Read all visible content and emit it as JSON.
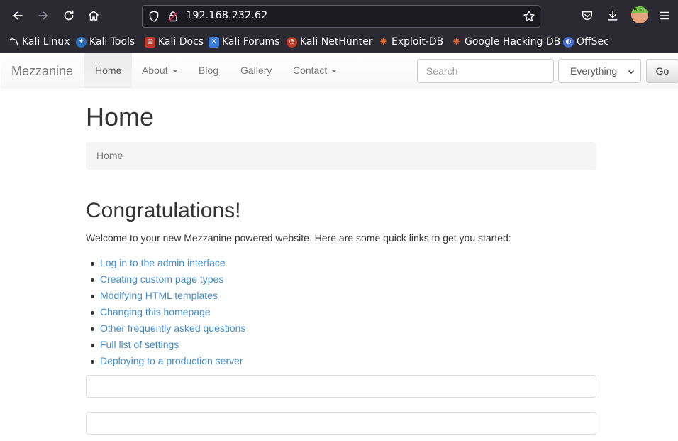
{
  "browser": {
    "url": "192.168.232.62",
    "burp_label": "Burp",
    "bookmarks": [
      {
        "label": "Kali Linux",
        "color": "#3b3b3b"
      },
      {
        "label": "Kali Tools",
        "color": "#2a6ebb"
      },
      {
        "label": "Kali Docs",
        "color": "#c0392b"
      },
      {
        "label": "Kali Forums",
        "color": "#3a7bd5"
      },
      {
        "label": "Kali NetHunter",
        "color": "#c0392b"
      },
      {
        "label": "Exploit-DB",
        "color": "#e0662a"
      },
      {
        "label": "Google Hacking DB",
        "color": "#e0662a"
      },
      {
        "label": "OffSec",
        "color": "#4a6fd6"
      }
    ]
  },
  "navbar": {
    "brand": "Mezzanine",
    "items": [
      {
        "label": "Home",
        "active": true
      },
      {
        "label": "About",
        "dropdown": true
      },
      {
        "label": "Blog"
      },
      {
        "label": "Gallery"
      },
      {
        "label": "Contact",
        "dropdown": true
      }
    ],
    "search_placeholder": "Search",
    "search_scope": "Everything",
    "go_label": "Go"
  },
  "main": {
    "title": "Home",
    "breadcrumb": "Home",
    "heading": "Congratulations!",
    "intro": "Welcome to your new Mezzanine powered website. Here are some quick links to get you started:",
    "links": [
      "Log in to the admin interface",
      "Creating custom page types",
      "Modifying HTML templates",
      "Changing this homepage",
      "Other frequently asked questions",
      "Full list of settings",
      "Deploying to a production server"
    ]
  },
  "colors": {
    "chrome_bg": "#2b2a33",
    "link": "#428bca",
    "text": "#333333"
  }
}
